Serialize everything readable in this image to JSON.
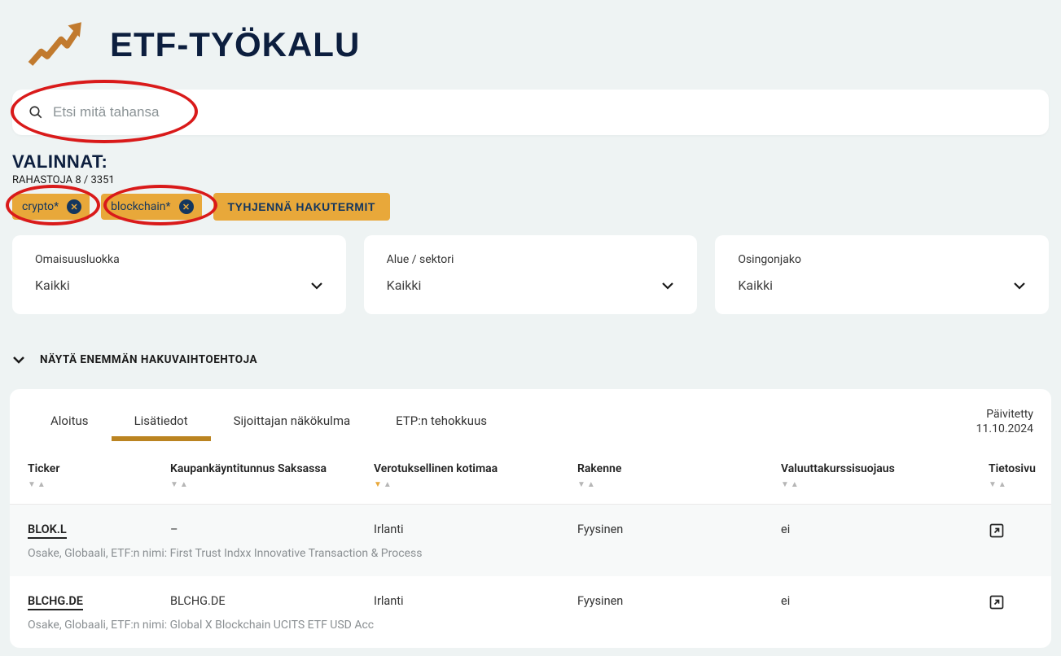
{
  "header": {
    "title": "ETF-TYÖKALU"
  },
  "search": {
    "placeholder": "Etsi mitä tahansa"
  },
  "selections": {
    "title": "VALINNAT:",
    "count_label": "RAHASTOJA 8 / 3351",
    "chips": [
      "crypto*",
      "blockchain*"
    ],
    "clear_label": "TYHJENNÄ HAKUTERMIT"
  },
  "filters": [
    {
      "label": "Omaisuusluokka",
      "value": "Kaikki"
    },
    {
      "label": "Alue / sektori",
      "value": "Kaikki"
    },
    {
      "label": "Osingonjako",
      "value": "Kaikki"
    }
  ],
  "expand_label": "NÄYTÄ ENEMMÄN HAKUVAIHTOEHTOJA",
  "tabs": {
    "items": [
      "Aloitus",
      "Lisätiedot",
      "Sijoittajan näkökulma",
      "ETP:n tehokkuus"
    ],
    "active_index": 1
  },
  "updated": {
    "label": "Päivitetty",
    "date": "11.10.2024"
  },
  "columns": [
    "Ticker",
    "Kaupankäyntitunnus Saksassa",
    "Verotuksellinen kotimaa",
    "Rakenne",
    "Valuuttakurssisuojaus",
    "Tietosivu"
  ],
  "rows": [
    {
      "ticker": "BLOK.L",
      "germany": "–",
      "domicile": "Irlanti",
      "structure": "Fyysinen",
      "hedge": "ei",
      "desc": "Osake, Globaali, ETF:n nimi: First Trust Indxx Innovative Transaction & Process"
    },
    {
      "ticker": "BLCHG.DE",
      "germany": "BLCHG.DE",
      "domicile": "Irlanti",
      "structure": "Fyysinen",
      "hedge": "ei",
      "desc": "Osake, Globaali, ETF:n nimi: Global X Blockchain UCITS ETF USD Acc"
    }
  ]
}
